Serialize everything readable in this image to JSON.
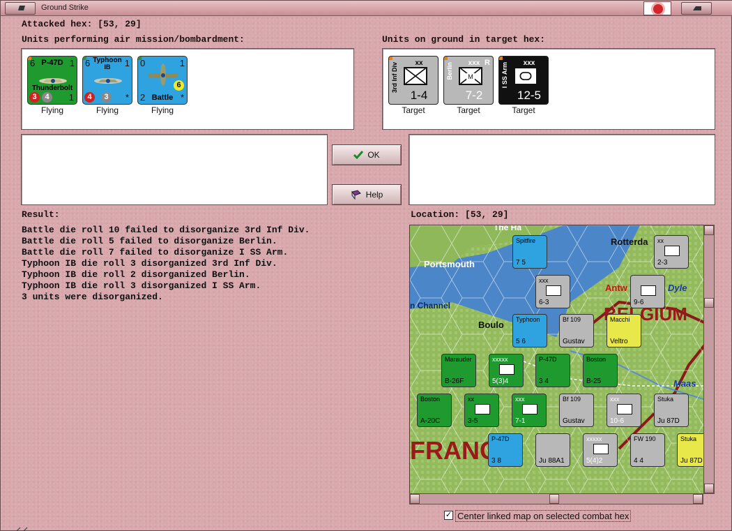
{
  "window": {
    "title": "Ground Strike"
  },
  "attacked_hex": {
    "label": "Attacked hex:",
    "value": "[53, 29]"
  },
  "air_units": {
    "label": "Units performing air mission/bombardment:",
    "items": [
      {
        "name": "P-47D",
        "subname": "Thunderbolt",
        "top_left": "6",
        "top_right": "1",
        "c1": "3",
        "c2": "4",
        "br": "1",
        "status": "Flying",
        "color": "#1e9a2e",
        "dot": "#e08020"
      },
      {
        "name": "Typhoon",
        "subname": "IB",
        "top_left": "6",
        "top_right": "1",
        "c1": "4",
        "c2": "3",
        "br": "*",
        "status": "Flying",
        "color": "#2fa3e0",
        "dot": "#3a8a3a"
      },
      {
        "name": "Battle",
        "subname": "",
        "top_left": "0",
        "top_right": "1",
        "c1": "2",
        "c2": "6",
        "br": "*",
        "status": "Flying",
        "color": "#2fa3e0",
        "dot": "#3a8a3a"
      }
    ]
  },
  "ground_units": {
    "label": "Units on ground in target hex:",
    "items": [
      {
        "side": "3rd Inf Div",
        "size": "xx",
        "val": "1-4",
        "status": "Target",
        "bg": "#b8b8b8",
        "fg": "#111",
        "sym": "x"
      },
      {
        "side": "Berlin",
        "size": "xxx",
        "val": "7-2",
        "status": "Target",
        "bg": "#b8b8b8",
        "fg": "#fff",
        "sym": "M",
        "extra": "R"
      },
      {
        "side": "I SS Arm",
        "size": "xxx",
        "val": "12-5",
        "status": "Target",
        "bg": "#111",
        "fg": "#fff",
        "sym": "o"
      }
    ]
  },
  "buttons": {
    "ok": "OK",
    "help": "Help"
  },
  "result": {
    "label": "Result:",
    "lines": [
      "Battle die roll 10 failed to disorganize 3rd Inf Div.",
      "Battle die roll 5 failed to disorganize Berlin.",
      "Battle die roll 7 failed to disorganize I SS Arm.",
      "Typhoon IB die roll 3 disorganized 3rd Inf Div.",
      "Typhoon IB die roll 2 disorganized Berlin.",
      "Typhoon IB die roll 3 disorganized I SS Arm.",
      "3 units were disorganized."
    ]
  },
  "location": {
    "label": "Location:",
    "value": "[53, 29]"
  },
  "map": {
    "labels": {
      "portsmouth": "Portsmouth",
      "channel": "n Channel",
      "rotterdam": "Rotterda",
      "antwerp": "Antw",
      "dyle": "Dyle",
      "belgium": "BELGIUM",
      "boulogne": "Boulo",
      "maas": "Maas",
      "france": "FRANC",
      "top": "The Ha"
    },
    "counters": [
      {
        "id": "spitfire",
        "top": "Spitfire",
        "bot": "7   5",
        "color": "#2fa3e0"
      },
      {
        "id": "xv",
        "top": "xxx",
        "bot": "6-3",
        "color": "#b8b8b8"
      },
      {
        "id": "2nd",
        "top": "xx",
        "bot": "2-3",
        "color": "#b8b8b8"
      },
      {
        "id": "996",
        "top": "",
        "bot": "9-6",
        "color": "#b8b8b8"
      },
      {
        "id": "typhoon2",
        "top": "Typhoon",
        "bot": "5  6",
        "color": "#2fa3e0"
      },
      {
        "id": "bf109a",
        "top": "Bf 109",
        "bot": "Gustav",
        "color": "#b8b8b8"
      },
      {
        "id": "macchi",
        "top": "Macchi",
        "bot": "Veltro",
        "color": "#e8e84a"
      },
      {
        "id": "five",
        "top": "xxxxx",
        "bot": "5(3)4",
        "color": "#1e9a2e"
      },
      {
        "id": "p47b",
        "top": "P-47D",
        "bot": "3  4",
        "color": "#1e9a2e"
      },
      {
        "id": "b25",
        "top": "Boston",
        "bot": "B-25",
        "color": "#1e9a2e"
      },
      {
        "id": "b26",
        "top": "Marauder",
        "bot": "B-26F",
        "color": "#1e9a2e"
      },
      {
        "id": "a20",
        "top": "Boston",
        "bot": "A-20C",
        "color": "#1e9a2e"
      },
      {
        "id": "35",
        "top": "xx",
        "bot": "3-5",
        "color": "#1e9a2e"
      },
      {
        "id": "71",
        "top": "xxx",
        "bot": "7-1",
        "color": "#1e9a2e"
      },
      {
        "id": "bf109b",
        "top": "Bf 109",
        "bot": "Gustav",
        "color": "#b8b8b8"
      },
      {
        "id": "106",
        "top": "xxx",
        "bot": "10-6",
        "color": "#b8b8b8"
      },
      {
        "id": "ju87",
        "top": "Stuka",
        "bot": "Ju 87D",
        "color": "#b8b8b8"
      },
      {
        "id": "p47c",
        "top": "P-47D",
        "bot": "3  8",
        "color": "#2fa3e0"
      },
      {
        "id": "ju88",
        "top": "",
        "bot": "Ju 88A1",
        "color": "#b8b8b8"
      },
      {
        "id": "542",
        "top": "xxxxx",
        "bot": "5(4)2",
        "color": "#b8b8b8"
      },
      {
        "id": "fw190",
        "top": "FW 190",
        "bot": "4  4",
        "color": "#b8b8b8"
      },
      {
        "id": "stuka2",
        "top": "Stuka",
        "bot": "Ju 87D",
        "color": "#e8e84a"
      }
    ]
  },
  "center_checkbox": {
    "label": "Center linked map on selected combat hex",
    "checked": "✓"
  }
}
